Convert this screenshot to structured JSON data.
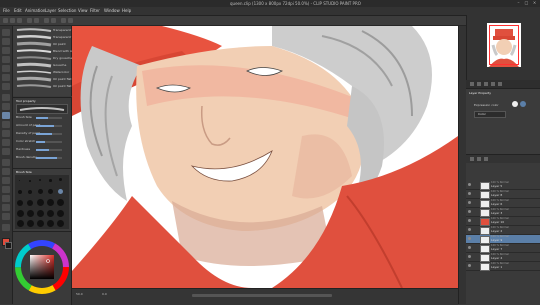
{
  "window": {
    "title": "queen.clip (1300 x 800px 72dpi 50.0%) - CLIP STUDIO PAINT PRO",
    "controls": [
      "–",
      "□",
      "×"
    ]
  },
  "menu": [
    "File",
    "Edit",
    "Animation",
    "Layer",
    "Selection",
    "View",
    "Filter",
    "Window",
    "Help"
  ],
  "subtool": {
    "brushes": [
      {
        "label": "Transparent Watercolor"
      },
      {
        "label": "Transparent Watercolor"
      },
      {
        "label": "Oil paint"
      },
      {
        "label": "Blend with oil paint"
      },
      {
        "label": "Dry gouache"
      },
      {
        "label": "Gouache"
      },
      {
        "label": "Watercolor"
      },
      {
        "label": "Oil paint flat brush"
      },
      {
        "label": "Oil paint flat brush"
      }
    ]
  },
  "tool_property": {
    "header": "Tool property",
    "rows": [
      {
        "label": "Brush Size",
        "level": 0.45
      },
      {
        "label": "Amount of paint",
        "level": 0.7
      },
      {
        "label": "Density of paint",
        "level": 0.6
      },
      {
        "label": "Color stretch",
        "level": 0.35
      },
      {
        "label": "Hardness",
        "level": 0.5
      },
      {
        "label": "Brush density",
        "level": 0.8
      }
    ]
  },
  "brush_size_palette": {
    "header": "Brush Size"
  },
  "color": {
    "main": "#e04c3c",
    "sub": "#1a1a1a"
  },
  "canvas": {
    "skin": "#f2cfb4",
    "hat": "#e8533f",
    "hair": "#c9c9c9",
    "shirt": "#e0503e"
  },
  "status": {
    "zoom": "50.0",
    "angle": "0.0"
  },
  "layer_property": {
    "header": "Layer Property",
    "expression_color": "Expression color",
    "color_label": "Color"
  },
  "layers": [
    {
      "name": "Layer 5",
      "mode": "100 % Normal"
    },
    {
      "name": "Layer 8",
      "mode": "100 % Normal"
    },
    {
      "name": "Layer 6",
      "mode": "100 % Normal"
    },
    {
      "name": "Layer 3",
      "mode": "100 % Normal"
    },
    {
      "name": "Layer 10",
      "mode": "100 % Normal"
    },
    {
      "name": "Layer 2",
      "mode": "100 % Normal"
    },
    {
      "name": "Layer 9",
      "mode": "100 % Normal",
      "selected": true
    },
    {
      "name": "Layer 7",
      "mode": "100 % Normal"
    },
    {
      "name": "Layer 4",
      "mode": "100 % Normal"
    },
    {
      "name": "Layer 1",
      "mode": "100 % Normal"
    }
  ]
}
